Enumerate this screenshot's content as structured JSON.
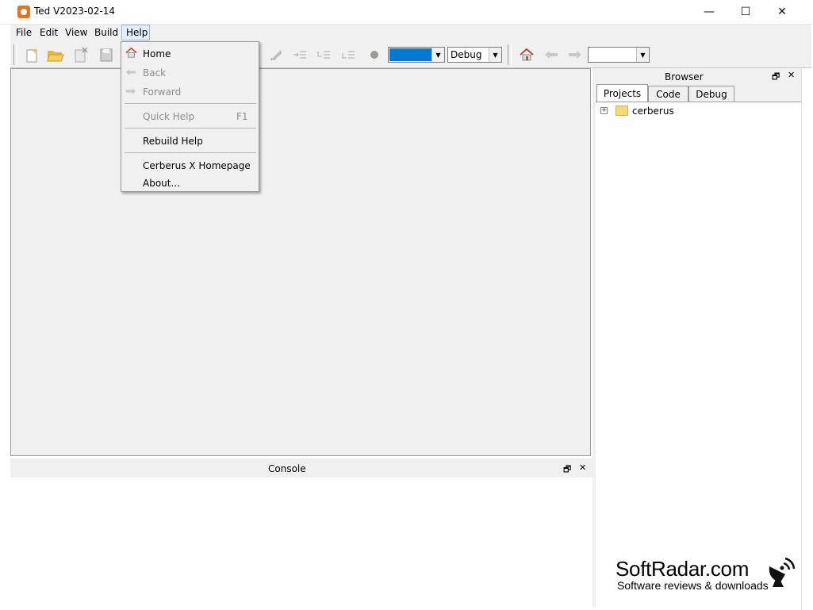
{
  "window": {
    "title": "Ted V2023-02-14",
    "minimize": "—",
    "maximize": "☐",
    "close": "✕"
  },
  "menubar": [
    "File",
    "Edit",
    "View",
    "Build",
    "Help"
  ],
  "toolbar": {
    "target_value": "",
    "config_value": "Debug",
    "nav_value": ""
  },
  "help_menu": {
    "items": [
      {
        "label": "Home",
        "enabled": true,
        "icon": "home-icon"
      },
      {
        "label": "Back",
        "enabled": false,
        "icon": "back-arrow-icon"
      },
      {
        "label": "Forward",
        "enabled": false,
        "icon": "forward-arrow-icon"
      },
      {
        "label": "Quick Help",
        "shortcut": "F1",
        "enabled": false
      },
      {
        "label": "Rebuild Help",
        "enabled": true
      },
      {
        "label": "Cerberus X Homepage",
        "enabled": true
      },
      {
        "label": "About...",
        "enabled": true
      }
    ]
  },
  "console": {
    "title": "Console"
  },
  "browser": {
    "title": "Browser",
    "tabs": [
      "Projects",
      "Code",
      "Debug"
    ],
    "active_tab": "Projects",
    "tree": [
      {
        "label": "cerberus",
        "expander": "+"
      }
    ]
  },
  "panel_controls": {
    "float": "🗗",
    "close": "✕"
  },
  "watermark": {
    "brand": "SoftRadar.com",
    "tagline": "Software reviews & downloads"
  },
  "colors": {
    "target_combo": "#0078d7",
    "app_icon": "#e8721c",
    "menu_bg": "#f0f0f0"
  }
}
